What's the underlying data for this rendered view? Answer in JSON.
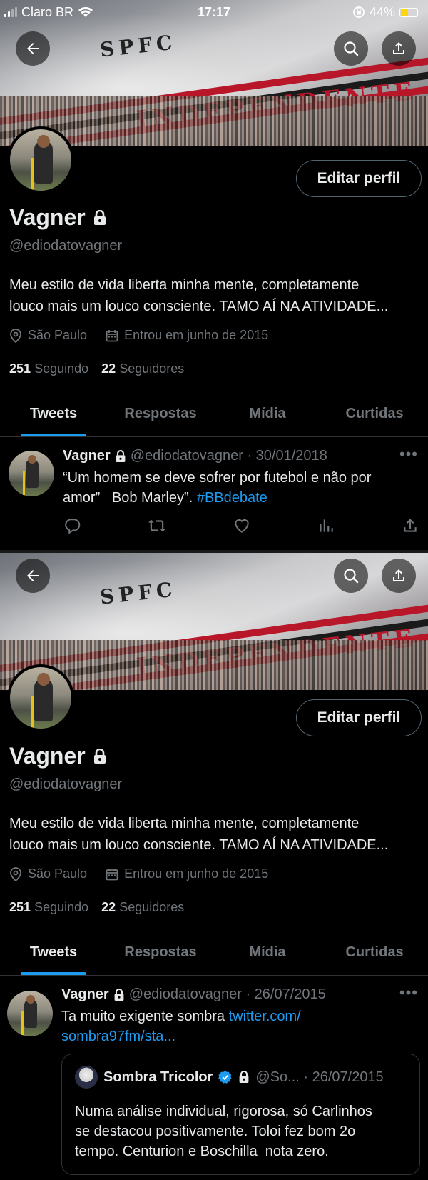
{
  "status_bar": {
    "carrier": "Claro BR",
    "time": "17:17",
    "battery": "44%",
    "battery_level": 0.44
  },
  "profile": {
    "name": "Vagner",
    "handle": "@ediodatovagner",
    "bio_line1": "Meu estilo de vida liberta minha mente, completamente",
    "bio_line2": "louco mais um louco consciente. TAMO AÍ NA ATIVIDADE...",
    "location": "São Paulo",
    "joined": "Entrou em junho de 2015",
    "following_count": "251",
    "following_label": "Seguindo",
    "followers_count": "22",
    "followers_label": "Seguidores",
    "edit_label": "Editar perfil"
  },
  "tabs": [
    {
      "label": "Tweets",
      "active": true
    },
    {
      "label": "Respostas",
      "active": false
    },
    {
      "label": "Mídia",
      "active": false
    },
    {
      "label": "Curtidas",
      "active": false
    }
  ],
  "tweet1": {
    "name": "Vagner",
    "meta": "@ediodatovagner · 30/01/2018",
    "text_line1": "“Um homem se deve sofrer por futebol e não por",
    "text_line2": "amor”   Bob Marley”.",
    "hashtag": "#BBdebate"
  },
  "tweet2": {
    "name": "Vagner",
    "meta": "@ediodatovagner · 26/07/2015",
    "text": "Ta muito exigente sombra",
    "link_line1": "twitter.com/",
    "link_line2": "sombra97fm/sta...",
    "quote": {
      "name": "Sombra Tricolor",
      "meta": "@So... · 26/07/2015",
      "text_line1": "Numa análise individual, rigorosa, só Carlinhos",
      "text_line2": "se destacou positivamente. Toloi fez bom 2o",
      "text_line3": "tempo. Centurion e Boschilla  nota zero."
    }
  },
  "colors": {
    "accent": "#1d9bf0",
    "muted": "#71767b",
    "background": "#000000",
    "text": "#e7e9ea"
  }
}
